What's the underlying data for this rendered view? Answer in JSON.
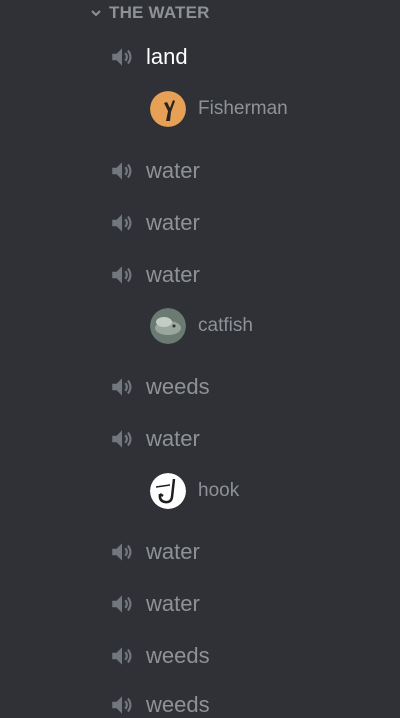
{
  "category": {
    "label": "THE WATER",
    "icon": "chevron-down-icon"
  },
  "channels": [
    {
      "label": "land",
      "icon": "speaker-icon"
    },
    {
      "label": "water",
      "icon": "speaker-icon"
    },
    {
      "label": "water",
      "icon": "speaker-icon"
    },
    {
      "label": "water",
      "icon": "speaker-icon"
    },
    {
      "label": "weeds",
      "icon": "speaker-icon"
    },
    {
      "label": "water",
      "icon": "speaker-icon"
    },
    {
      "label": "water",
      "icon": "speaker-icon"
    },
    {
      "label": "water",
      "icon": "speaker-icon"
    },
    {
      "label": "weeds",
      "icon": "speaker-icon"
    },
    {
      "label": "weeds",
      "icon": "speaker-icon"
    }
  ],
  "users": [
    {
      "name": "Fisherman",
      "avatar": "fisherman-avatar"
    },
    {
      "name": "catfish",
      "avatar": "catfish-avatar"
    },
    {
      "name": "hook",
      "avatar": "hook-avatar"
    }
  ],
  "colors": {
    "background": "#2f3136",
    "muted_text": "#8e9297",
    "active_text": "#ffffff"
  }
}
